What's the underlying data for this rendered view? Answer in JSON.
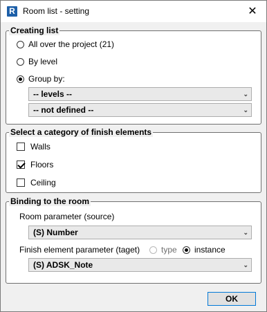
{
  "window": {
    "title": "Room list - setting",
    "app_icon_letter": "R",
    "close_symbol": "✕"
  },
  "creating_list": {
    "legend": "Creating list",
    "options": [
      {
        "label": "All over the project (21)",
        "checked": false
      },
      {
        "label": "By level",
        "checked": false
      },
      {
        "label": "Group by:",
        "checked": true
      }
    ],
    "group_select_1": "-- levels --",
    "group_select_2": "-- not defined --"
  },
  "category": {
    "legend": "Select a category of finish elements",
    "items": [
      {
        "label": "Walls",
        "checked": false
      },
      {
        "label": "Floors",
        "checked": true
      },
      {
        "label": "Ceiling",
        "checked": false
      }
    ]
  },
  "binding": {
    "legend": "Binding to the room",
    "room_param_label": "Room parameter (source)",
    "room_param_value": "(S) Number",
    "finish_param_label": "Finish element parameter (taget)",
    "type_label": "type",
    "instance_label": "instance",
    "finish_param_value": "(S) ADSK_Note"
  },
  "footer": {
    "ok_label": "OK"
  }
}
